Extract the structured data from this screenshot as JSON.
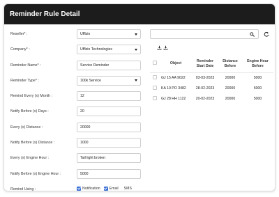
{
  "header": {
    "title": "Reminder Rule Detail"
  },
  "form": {
    "reseller": {
      "label": "Reseller*  :",
      "value": "Ufflzio"
    },
    "company": {
      "label": "Company*  :",
      "value": "Ufflzio Technologies"
    },
    "reminder_name": {
      "label": "Reminder Name*  :",
      "value": "Service Reminder"
    },
    "reminder_type": {
      "label": "Reminder Type*  :",
      "value": "100k Service"
    },
    "remind_every_month": {
      "label": "Remind Every (x) Month  :",
      "value": "12"
    },
    "notify_before_days": {
      "label": "Notify Before (x) Days  :",
      "value": "20"
    },
    "every_distance": {
      "label": "Every (x) Distance  :",
      "value": "20000"
    },
    "notify_before_distance": {
      "label": "Notify Before (x) Distance  :",
      "value": "1000"
    },
    "every_engine_hour": {
      "label": "Every (x) Engine Hour  :",
      "value": "Tail light broken"
    },
    "notify_before_engine_hour": {
      "label": "Notify Before (x) Engine Hour  :",
      "value": "5000"
    },
    "remind_using": {
      "label": "Remind Using  :",
      "notification": "Notification",
      "email": "Email",
      "sms": "SMS"
    }
  },
  "table": {
    "headers": {
      "object": "Object",
      "start_l1": "Reminder",
      "start_l2": "Start Date",
      "dist_l1": "Distance",
      "dist_l2": "Before",
      "eh_l1": "Engine Hour",
      "eh_l2": "Before"
    },
    "rows": [
      {
        "object": "GJ 15 AA 9022",
        "start_date": "03-03-2023",
        "distance": "20000",
        "engine_hour": "5000"
      },
      {
        "object": "KA 10 PO 3482",
        "start_date": "28-02-2023",
        "distance": "20000",
        "engine_hour": "5000"
      },
      {
        "object": "GJ 28 HH 1122",
        "start_date": "20-02-2023",
        "distance": "20000",
        "engine_hour": "5000"
      }
    ]
  },
  "colors": {
    "header_bg": "#1c1c1c",
    "checkbox_accent": "#3b6fd6"
  },
  "icons": [
    "search-icon",
    "refresh-icon",
    "download-icon",
    "export-icon",
    "chevron-down-icon"
  ]
}
